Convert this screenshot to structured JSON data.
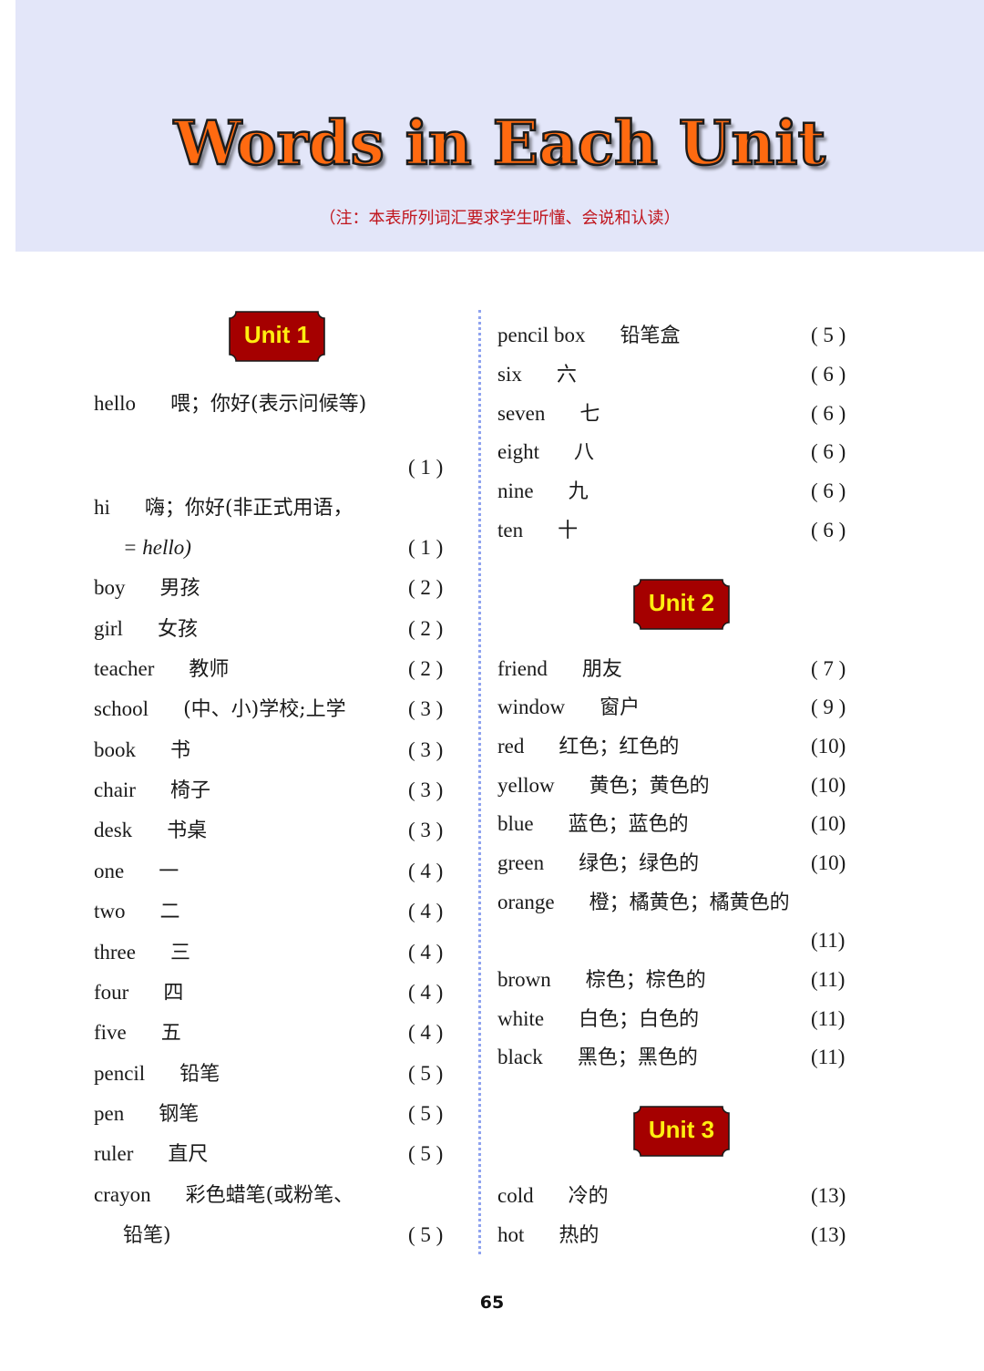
{
  "header": {
    "title": "Words in Each Unit",
    "note": "（注：本表所列词汇要求学生听懂、会说和认读）",
    "colors": {
      "band": "#e3e6f9",
      "title_fill": "#ff6a10",
      "note": "#c0141c"
    }
  },
  "badge_colors": {
    "fill": "#a50000",
    "text": "#ffee10"
  },
  "units": [
    {
      "label": "Unit 1",
      "words": [
        {
          "en": "hello",
          "zh": "喂；你好(表示问候等)",
          "page": "( 1 )"
        },
        {
          "en": "hi",
          "zh": "嗨；你好(非正式用语，",
          "zh_cont": "= hello)",
          "page": "( 1 )"
        },
        {
          "en": "boy",
          "zh": "男孩",
          "page": "( 2 )"
        },
        {
          "en": "girl",
          "zh": "女孩",
          "page": "( 2 )"
        },
        {
          "en": "teacher",
          "zh": "教师",
          "page": "( 2 )"
        },
        {
          "en": "school",
          "zh": "(中、小)学校;上学",
          "page": "( 3 )"
        },
        {
          "en": "book",
          "zh": "书",
          "page": "( 3 )"
        },
        {
          "en": "chair",
          "zh": "椅子",
          "page": "( 3 )"
        },
        {
          "en": "desk",
          "zh": "书桌",
          "page": "( 3 )"
        },
        {
          "en": "one",
          "zh": "一",
          "page": "( 4 )"
        },
        {
          "en": "two",
          "zh": "二",
          "page": "( 4 )"
        },
        {
          "en": "three",
          "zh": "三",
          "page": "( 4 )"
        },
        {
          "en": "four",
          "zh": "四",
          "page": "( 4 )"
        },
        {
          "en": "five",
          "zh": "五",
          "page": "( 4 )"
        },
        {
          "en": "pencil",
          "zh": "铅笔",
          "page": "( 5 )"
        },
        {
          "en": "pen",
          "zh": "钢笔",
          "page": "( 5 )"
        },
        {
          "en": "ruler",
          "zh": "直尺",
          "page": "( 5 )"
        },
        {
          "en": "crayon",
          "zh": "彩色蜡笔(或粉笔、",
          "zh_cont": "铅笔)",
          "page": "( 5 )"
        },
        {
          "en": "pencil box",
          "zh": "铅笔盒",
          "page": "( 5 )"
        },
        {
          "en": "six",
          "zh": "六",
          "page": "( 6 )"
        },
        {
          "en": "seven",
          "zh": "七",
          "page": "( 6 )"
        },
        {
          "en": "eight",
          "zh": "八",
          "page": "( 6 )"
        },
        {
          "en": "nine",
          "zh": "九",
          "page": "( 6 )"
        },
        {
          "en": "ten",
          "zh": "十",
          "page": "( 6 )"
        }
      ]
    },
    {
      "label": "Unit 2",
      "words": [
        {
          "en": "friend",
          "zh": "朋友",
          "page": "( 7 )"
        },
        {
          "en": "window",
          "zh": "窗户",
          "page": "( 9 )"
        },
        {
          "en": "red",
          "zh": "红色；红色的",
          "page": "(10)"
        },
        {
          "en": "yellow",
          "zh": "黄色；黄色的",
          "page": "(10)"
        },
        {
          "en": "blue",
          "zh": "蓝色；蓝色的",
          "page": "(10)"
        },
        {
          "en": "green",
          "zh": "绿色；绿色的",
          "page": "(10)"
        },
        {
          "en": "orange",
          "zh": "橙；橘黄色；橘黄色的",
          "page": "(11)"
        },
        {
          "en": "brown",
          "zh": "棕色；棕色的",
          "page": "(11)"
        },
        {
          "en": "white",
          "zh": "白色；白色的",
          "page": "(11)"
        },
        {
          "en": "black",
          "zh": "黑色；黑色的",
          "page": "(11)"
        }
      ]
    },
    {
      "label": "Unit 3",
      "words": [
        {
          "en": "cold",
          "zh": "冷的",
          "page": "(13)"
        },
        {
          "en": "hot",
          "zh": "热的",
          "page": "(13)"
        }
      ]
    }
  ],
  "footer": {
    "page_number": "65"
  }
}
